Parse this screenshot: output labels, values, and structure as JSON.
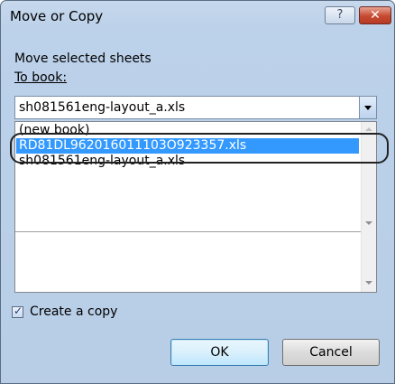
{
  "window": {
    "title": "Move or Copy",
    "help_glyph": "?",
    "close_glyph": "✕"
  },
  "labels": {
    "move_selected": "Move selected sheets",
    "to_book": "To book:"
  },
  "combo": {
    "value": "sh081561eng-layout_a.xls"
  },
  "list": {
    "items": [
      {
        "label": "(new book)",
        "selected": false
      },
      {
        "label": "RD81DL962016011103O923357.xls",
        "selected": true
      },
      {
        "label": "sh081561eng-layout_a.xls",
        "selected": false
      }
    ]
  },
  "checkbox": {
    "label": "Create a copy",
    "checked": true
  },
  "buttons": {
    "ok": "OK",
    "cancel": "Cancel"
  },
  "colors": {
    "selection": "#3399ff",
    "title_gradient": "#c7d8ec",
    "close_button": "#c64a31"
  }
}
